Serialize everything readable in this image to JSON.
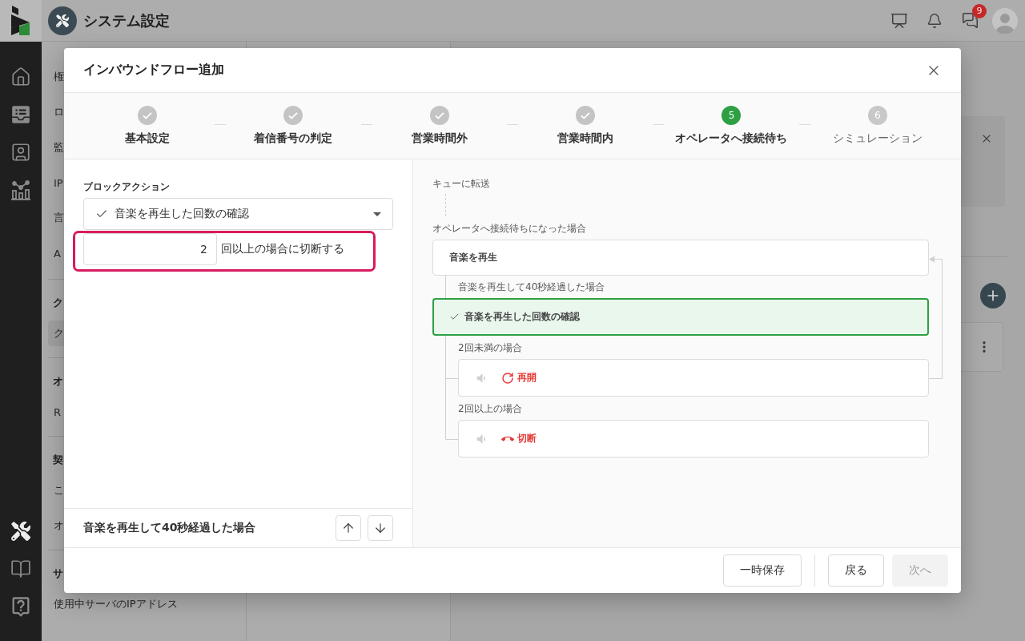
{
  "header": {
    "title": "システム設定",
    "chat_badge": "9"
  },
  "sidebar": {
    "top": [
      {
        "selected": false
      },
      {
        "selected": false
      },
      {
        "selected": false
      },
      {
        "selected": false
      }
    ],
    "bottom": [
      {
        "selected": true
      },
      {
        "selected": false
      },
      {
        "selected": false
      }
    ]
  },
  "nav": {
    "groups": [
      {
        "items": [
          {
            "label": "権",
            "selected": false
          },
          {
            "label": "ロ",
            "selected": false
          },
          {
            "label": "監",
            "selected": false
          },
          {
            "label": "IP",
            "selected": false
          },
          {
            "label": "言",
            "selected": false
          },
          {
            "label": "A",
            "selected": false
          }
        ]
      },
      {
        "heading": "ク",
        "items": [
          {
            "label": "ク",
            "selected": true
          }
        ]
      },
      {
        "heading": "オ",
        "items": [
          {
            "label": "R",
            "selected": false
          }
        ]
      },
      {
        "heading": "契",
        "items": [
          {
            "label": "こ",
            "selected": false
          },
          {
            "label": "オ",
            "selected": false
          }
        ]
      },
      {
        "heading": "サ",
        "items": [
          {
            "label": "使用中サーバのIPアドレス",
            "selected": false
          }
        ]
      }
    ]
  },
  "dialog": {
    "title": "インバウンドフロー追加",
    "steps": [
      {
        "label": "基本設定",
        "completed": true,
        "selected": false
      },
      {
        "label": "着信番号の判定",
        "completed": true,
        "selected": false
      },
      {
        "label": "営業時間外",
        "completed": true,
        "selected": false
      },
      {
        "label": "営業時間内",
        "completed": true,
        "selected": false
      },
      {
        "number": "5",
        "label": "オペレータへ接続待ち",
        "completed": false,
        "selected": true
      },
      {
        "number": "6",
        "label": "シミュレーション",
        "completed": false,
        "selected": false
      }
    ],
    "block_action": {
      "label": "ブロックアクション",
      "value": "音楽を再生した回数の確認",
      "count": "2",
      "suffix": "回以上の場合に切断する",
      "highlighted": true
    },
    "block_footer": {
      "title": "音楽を再生して40秒経過した場合"
    },
    "flow": {
      "start": "キューに転送",
      "trigger": "オペレータへ接続待ちになった場合",
      "blocks": [
        {
          "label": "音楽を再生",
          "selected": false
        },
        {
          "condition": "音楽を再生して40秒経過した場合",
          "label": "音楽を再生した回数の確認",
          "selected": true,
          "branches": [
            {
              "condition": "2回未満の場合",
              "kind": "restart",
              "label": "再開"
            },
            {
              "condition": "2回以上の場合",
              "kind": "hangup",
              "label": "切断"
            }
          ]
        }
      ]
    },
    "buttons": {
      "secondary": [
        {
          "label": "一時保存",
          "disabled": false
        }
      ],
      "navigation": [
        {
          "label": "戻る",
          "disabled": false
        },
        {
          "label": "次へ",
          "disabled": true
        }
      ]
    }
  }
}
